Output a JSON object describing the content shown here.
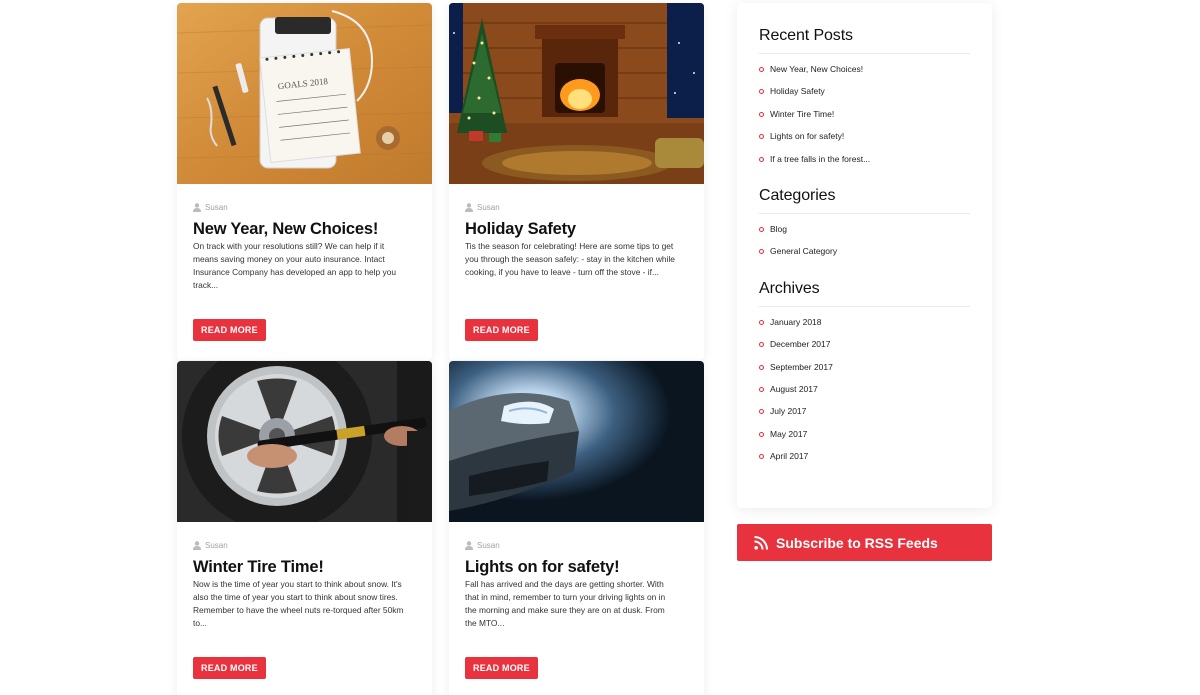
{
  "posts": [
    {
      "author": "Susan",
      "title": "New Year, New Choices!",
      "excerpt": "On track with your resolutions still?  We can help if it means saving money on your auto insurance. Intact Insurance Company has developed an app to help you track...",
      "read_more": "READ MORE",
      "image_icon": "goals-notebook-image",
      "image_text": "GOALS 2018"
    },
    {
      "author": "Susan",
      "title": "Holiday Safety",
      "excerpt": "Tis the season for celebrating! Here are some tips to get you through the season safely: - stay in the kitchen while cooking, if you have to leave - turn off the stove - if...",
      "read_more": "READ MORE",
      "image_icon": "christmas-fireplace-image"
    },
    {
      "author": "Susan",
      "title": "Winter Tire Time!",
      "excerpt": "Now is the time of year you start to think about snow. It's also the time of year you start to think about snow tires. Remember to have the wheel nuts re-torqued after 50km to...",
      "read_more": "READ MORE",
      "image_icon": "tire-wrench-image"
    },
    {
      "author": "Susan",
      "title": "Lights on for safety!",
      "excerpt": "Fall has arrived and the days are getting shorter. With that in mind, remember to turn your driving lights on in the morning and make sure they are on at dusk. From the MTO...",
      "read_more": "READ MORE",
      "image_icon": "car-headlight-image"
    }
  ],
  "sidebar": {
    "recent_posts": {
      "title": "Recent Posts",
      "items": [
        "New Year, New Choices!",
        "Holiday Safety",
        "Winter Tire Time!",
        "Lights on for safety!",
        "If a tree falls in the forest..."
      ]
    },
    "categories": {
      "title": "Categories",
      "items": [
        "Blog",
        "General Category"
      ]
    },
    "archives": {
      "title": "Archives",
      "items": [
        "January 2018",
        "December 2017",
        "September 2017",
        "August 2017",
        "July 2017",
        "May 2017",
        "April 2017"
      ]
    }
  },
  "rss": {
    "label": "Subscribe to RSS Feeds",
    "icon": "rss-icon"
  },
  "colors": {
    "accent": "#e8323e",
    "meta": "#a0a0a0"
  }
}
